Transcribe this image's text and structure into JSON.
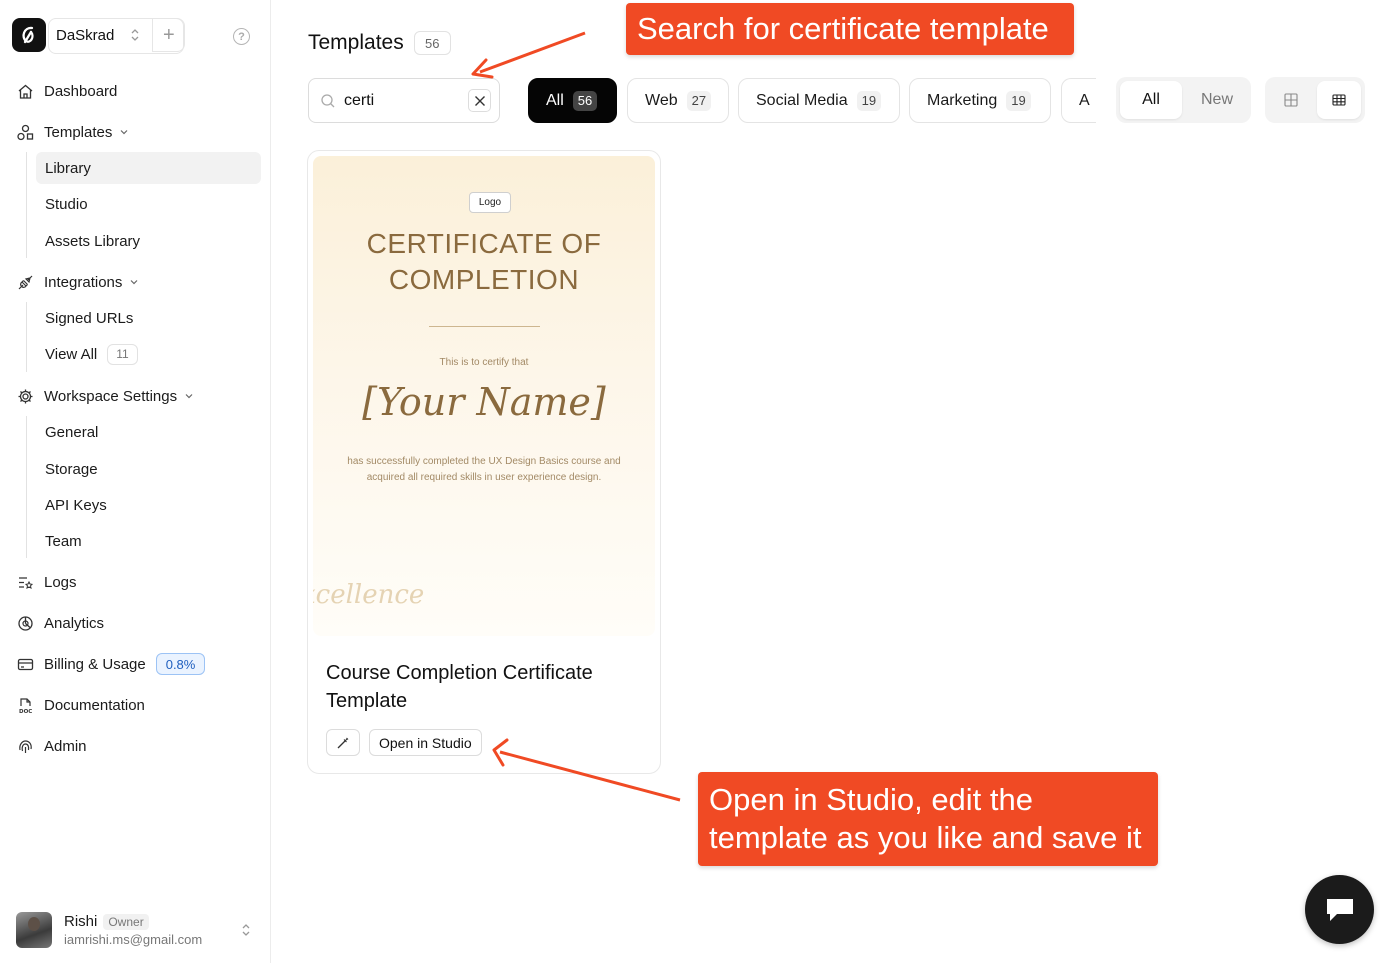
{
  "workspace": {
    "name": "DaSkrad",
    "add_label": "+"
  },
  "sidebar": {
    "items": [
      {
        "label": "Dashboard",
        "icon": "home-icon"
      },
      {
        "label": "Templates",
        "icon": "shapes-icon",
        "children": [
          "Library",
          "Studio",
          "Assets Library"
        ],
        "active_child": "Library"
      },
      {
        "label": "Integrations",
        "icon": "plug-icon",
        "children": [
          "Signed URLs",
          "View All"
        ],
        "view_all_count": "11"
      },
      {
        "label": "Workspace Settings",
        "icon": "gear-icon",
        "children": [
          "General",
          "Storage",
          "API Keys",
          "Team"
        ]
      },
      {
        "label": "Logs",
        "icon": "logs-icon"
      },
      {
        "label": "Analytics",
        "icon": "analytics-icon"
      },
      {
        "label": "Billing & Usage",
        "icon": "billing-icon",
        "badge": "0.8%"
      },
      {
        "label": "Documentation",
        "icon": "doc-icon"
      },
      {
        "label": "Admin",
        "icon": "fingerprint-icon"
      }
    ]
  },
  "user": {
    "name": "Rishi",
    "role": "Owner",
    "email": "iamrishi.ms@gmail.com"
  },
  "main": {
    "title": "Templates",
    "title_count": "56",
    "search": {
      "value": "certi",
      "icon": "search-icon"
    },
    "filters": [
      {
        "label": "All",
        "count": "56",
        "active": true
      },
      {
        "label": "Web",
        "count": "27"
      },
      {
        "label": "Social Media",
        "count": "19"
      },
      {
        "label": "Marketing",
        "count": "19"
      },
      {
        "label": "A"
      }
    ],
    "status_toggle": {
      "all": "All",
      "new": "New"
    },
    "view_icons": [
      "grid-view-icon",
      "table-view-icon"
    ]
  },
  "card": {
    "preview": {
      "logo": "Logo",
      "title_line1": "CERTIFICATE OF",
      "title_line2": "COMPLETION",
      "certify": "This is to certify that",
      "name": "[Your Name]",
      "desc_line1": "has successfully completed the UX Design Basics course and",
      "desc_line2": "acquired all required skills in user experience design.",
      "watermark": "xcellence"
    },
    "title": "Course Completion Certificate Template",
    "open_label": "Open in Studio"
  },
  "annotations": {
    "top": "Search for certificate template",
    "bottom": "Open in Studio, edit the template as you like and save it"
  },
  "colors": {
    "accent": "#f04a24",
    "cert_text": "#8a6a3e",
    "chip_active": "#050505",
    "badge_blue": "#1f5fbf"
  }
}
